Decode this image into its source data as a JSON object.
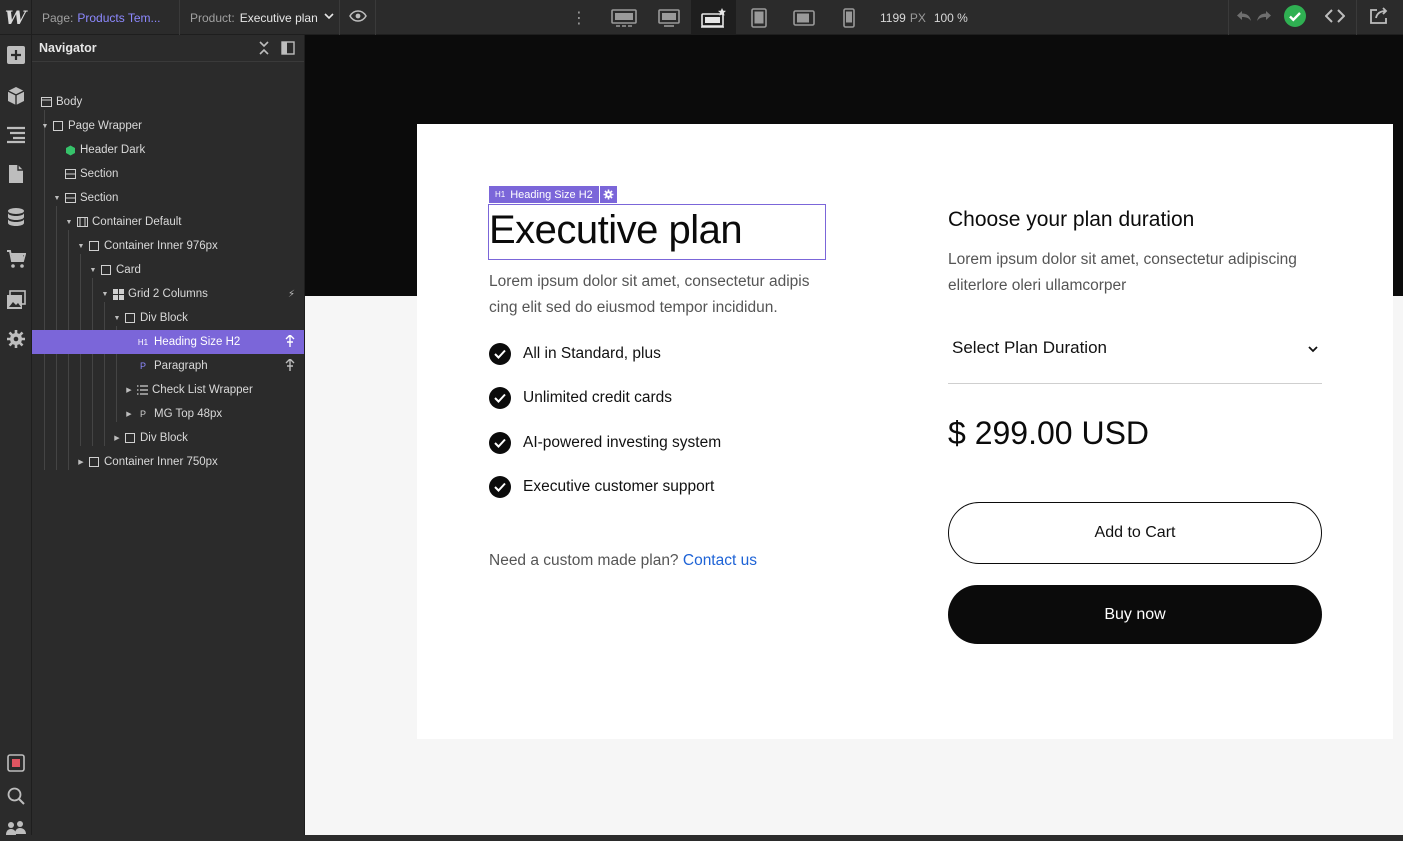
{
  "topbar": {
    "logo": "W",
    "page_label": "Page:",
    "page_value": "Products Tem...",
    "product_label": "Product:",
    "product_value": "Executive plan",
    "canvas_width": "1199",
    "canvas_unit": "PX",
    "zoom": "100 %",
    "breakpoints": [
      "desktop-large",
      "desktop-medium",
      "desktop-base",
      "tablet",
      "mobile-landscape",
      "mobile-portrait"
    ],
    "active_breakpoint": "desktop-base",
    "colors": {
      "accent": "#7b66d9",
      "publish_ok": "#2fb052"
    }
  },
  "left_rail": {
    "icons": [
      "add-icon",
      "components-icon",
      "navigator-icon",
      "pages-icon",
      "cms-icon",
      "ecommerce-icon",
      "assets-icon",
      "settings-icon",
      "audit-icon",
      "search-icon",
      "users-icon"
    ]
  },
  "navigator": {
    "title": "Navigator",
    "items": [
      {
        "label": "Body",
        "icon": "body-icon"
      },
      {
        "label": "Page Wrapper",
        "icon": "box-icon"
      },
      {
        "label": "Header Dark",
        "icon": "component-icon"
      },
      {
        "label": "Section",
        "icon": "section-icon"
      },
      {
        "label": "Section",
        "icon": "section-icon"
      },
      {
        "label": "Container Default",
        "icon": "container-icon"
      },
      {
        "label": "Container Inner 976px",
        "icon": "box-icon"
      },
      {
        "label": "Card",
        "icon": "box-icon"
      },
      {
        "label": "Grid 2 Columns",
        "icon": "grid-icon"
      },
      {
        "label": "Div Block",
        "icon": "box-icon"
      },
      {
        "label": "Heading Size H2",
        "icon": "heading-icon",
        "glyph": "H1",
        "selected": true
      },
      {
        "label": "Paragraph",
        "icon": "paragraph-icon",
        "glyph": "P"
      },
      {
        "label": "Check List Wrapper",
        "icon": "list-icon"
      },
      {
        "label": "MG Top 48px",
        "icon": "paragraph-icon",
        "glyph": "P"
      },
      {
        "label": "Div Block",
        "icon": "box-icon"
      },
      {
        "label": "Container Inner 750px",
        "icon": "box-icon"
      }
    ]
  },
  "canvas": {
    "selection_tag": "Heading Size H2",
    "selection_glyph": "H1",
    "plan_title": "Executive plan",
    "plan_description": "Lorem ipsum dolor sit amet, consectetur adipis cing elit sed do eiusmod tempor incididun.",
    "features": [
      "All in Standard, plus",
      "Unlimited credit cards",
      "AI-powered investing system",
      "Executive customer support"
    ],
    "custom_text": "Need a custom made plan?",
    "custom_link": "Contact us",
    "duration_title": "Choose your plan duration",
    "duration_description": "Lorem ipsum dolor sit amet, consectetur adipiscing eliterlore oleri ullamcorper",
    "select_placeholder": "Select Plan Duration",
    "price": "$ 299.00 USD",
    "add_to_cart": "Add to Cart",
    "buy_now": "Buy now"
  }
}
